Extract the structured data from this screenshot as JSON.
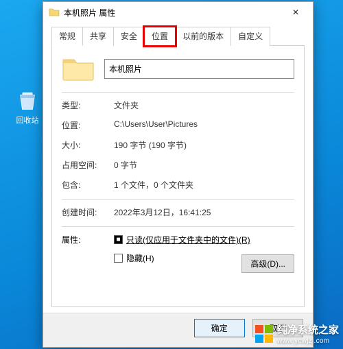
{
  "window": {
    "title": "本机照片 属性",
    "close_label": "✕"
  },
  "tabs": {
    "general": "常规",
    "sharing": "共享",
    "security": "安全",
    "location": "位置",
    "previous": "以前的版本",
    "custom": "自定义"
  },
  "general": {
    "folder_name": "本机照片",
    "labels": {
      "type": "类型:",
      "location": "位置:",
      "size": "大小:",
      "size_on_disk": "占用空间:",
      "contains": "包含:",
      "created": "创建时间:",
      "attributes": "属性:"
    },
    "values": {
      "type": "文件夹",
      "location": "C:\\Users\\User\\Pictures",
      "size": "190 字节 (190 字节)",
      "size_on_disk": "0 字节",
      "contains": "1 个文件，0 个文件夹",
      "created": "2022年3月12日，16:41:25"
    },
    "readonly_label": "只读(仅应用于文件夹中的文件)(R)",
    "hidden_label": "隐藏(H)",
    "advanced_label": "高级(D)..."
  },
  "buttons": {
    "ok": "确定",
    "cancel": "取消"
  },
  "desktop": {
    "recycle_bin": "回收站"
  },
  "watermark": {
    "name": "纯净系统之家",
    "url": "www.ycwjzj.com"
  }
}
